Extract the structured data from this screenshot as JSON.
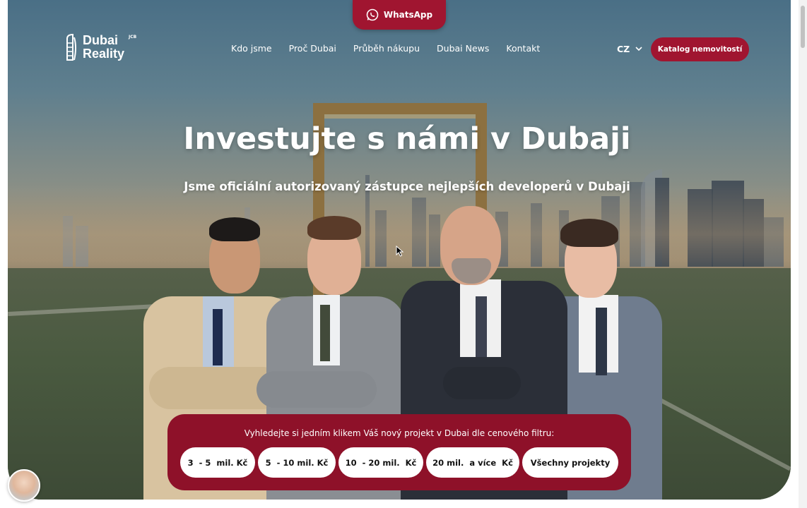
{
  "whatsapp": {
    "label": "WhatsApp",
    "icon": "whatsapp-icon"
  },
  "logo": {
    "line1": "Dubai",
    "line2": "Reality",
    "sup": "JCB"
  },
  "nav": {
    "items": [
      {
        "label": "Kdo jsme"
      },
      {
        "label": "Proč Dubai"
      },
      {
        "label": "Průběh nákupu"
      },
      {
        "label": "Dubai News"
      },
      {
        "label": "Kontakt"
      }
    ]
  },
  "language": {
    "value": "CZ",
    "icon": "chevron-down-icon"
  },
  "catalog_button": {
    "label": "Katalog nemovitostí"
  },
  "hero": {
    "title": "Investujte s námi v Dubaji",
    "subtitle": "Jsme oficiální autorizovaný  zástupce nejlepších developerů v Dubaji"
  },
  "filter": {
    "text": "Vyhledejte si jedním klikem Váš nový projekt v Dubai dle cenového filtru:",
    "buttons": [
      {
        "label": "3  - 5  mil. Kč"
      },
      {
        "label": "5  - 10 mil. Kč"
      },
      {
        "label": "10  - 20 mil.  Kč"
      },
      {
        "label": "20 mil.  a více  Kč"
      },
      {
        "label": "Všechny projekty"
      }
    ]
  },
  "colors": {
    "brand": "#a01530",
    "panel": "#8e1129",
    "text_on_brand": "#ffffff"
  }
}
